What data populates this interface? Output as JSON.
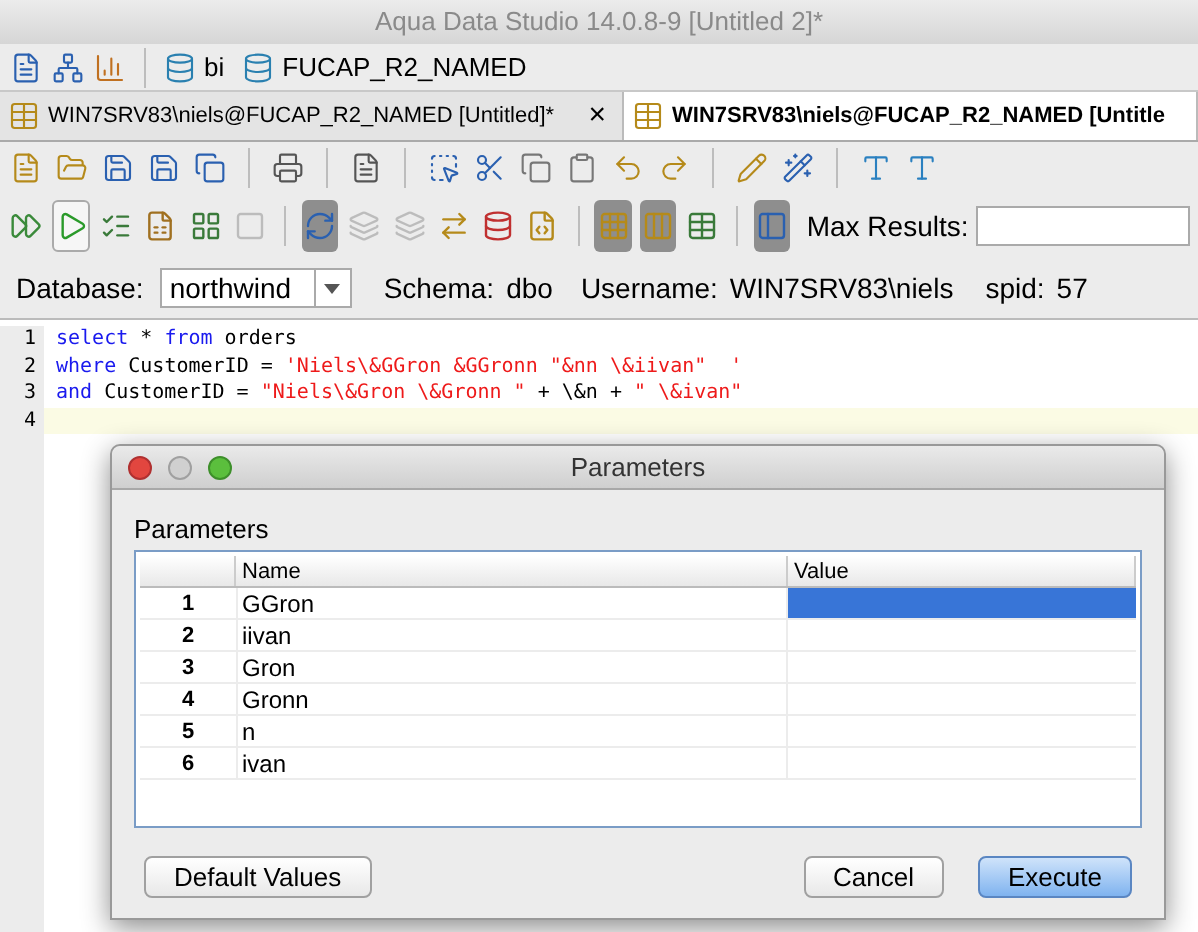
{
  "window": {
    "title": "Aqua Data Studio 14.0.8-9 [Untitled 2]*"
  },
  "connections": [
    {
      "label": "bi"
    },
    {
      "label": "FUCAP_R2_NAMED"
    }
  ],
  "tabs": [
    {
      "label": "WIN7SRV83\\niels@FUCAP_R2_NAMED [Untitled]*",
      "selected": false,
      "close": "×"
    },
    {
      "label": "WIN7SRV83\\niels@FUCAP_R2_NAMED [Untitle",
      "selected": true
    }
  ],
  "query_toolbar": [
    {
      "pressed": false,
      "disabled": false
    },
    {
      "pressed": false,
      "disabled": false,
      "outlined": true
    },
    {
      "pressed": false,
      "disabled": false
    },
    {
      "pressed": false,
      "disabled": false
    },
    {
      "pressed": false,
      "disabled": false
    },
    {
      "pressed": false,
      "disabled": true
    },
    {
      "pressed": true,
      "disabled": false
    },
    {
      "pressed": false,
      "disabled": true
    },
    {
      "pressed": false,
      "disabled": true
    },
    {
      "pressed": false,
      "disabled": false
    },
    {
      "pressed": false,
      "disabled": false
    },
    {
      "pressed": false,
      "disabled": false
    },
    {
      "pressed": true,
      "disabled": false
    },
    {
      "pressed": true,
      "disabled": false
    },
    {
      "pressed": false,
      "disabled": false
    },
    {
      "pressed": true,
      "disabled": false
    }
  ],
  "max_results": {
    "label": "Max Results:"
  },
  "context": {
    "database_label": "Database:",
    "database": "northwind",
    "schema_label": "Schema:",
    "schema": "dbo",
    "username_label": "Username:",
    "username": "WIN7SRV83\\niels",
    "spid_label": "spid:",
    "spid": "57"
  },
  "editor": {
    "lines": [
      {
        "number": "1",
        "tokens": [
          {
            "kind": "keyword",
            "text": "select"
          },
          {
            "kind": "plain",
            "text": " * "
          },
          {
            "kind": "keyword",
            "text": "from"
          },
          {
            "kind": "plain",
            "text": " orders"
          }
        ],
        "current": false
      },
      {
        "number": "2",
        "tokens": [
          {
            "kind": "keyword",
            "text": "where"
          },
          {
            "kind": "plain",
            "text": " CustomerID = "
          },
          {
            "kind": "string",
            "text": "'Niels\\&GGron &GGronn \"&nn \\&iivan\"  '"
          }
        ],
        "current": false
      },
      {
        "number": "3",
        "tokens": [
          {
            "kind": "keyword",
            "text": "and"
          },
          {
            "kind": "plain",
            "text": " CustomerID = "
          },
          {
            "kind": "string",
            "text": "\"Niels\\&Gron \\&Gronn \""
          },
          {
            "kind": "plain",
            "text": " + \\&n + "
          },
          {
            "kind": "string",
            "text": "\" \\&ivan\""
          }
        ],
        "current": false
      },
      {
        "number": "4",
        "current": true
      }
    ]
  },
  "dialog": {
    "title": "Parameters",
    "section_label": "Parameters",
    "columns": [
      "Name",
      "Value"
    ],
    "rows": [
      {
        "index": "1",
        "name": "GGron",
        "selected": true
      },
      {
        "index": "2",
        "name": "iivan",
        "selected": false
      },
      {
        "index": "3",
        "name": "Gron",
        "selected": false
      },
      {
        "index": "4",
        "name": "Gronn",
        "selected": false
      },
      {
        "index": "5",
        "name": "n",
        "selected": false
      },
      {
        "index": "6",
        "name": "ivan",
        "selected": false
      }
    ],
    "buttons": [
      {
        "label": "Default Values",
        "default": false
      },
      {
        "label": "Cancel",
        "default": false
      },
      {
        "label": "Execute",
        "default": true
      }
    ]
  }
}
